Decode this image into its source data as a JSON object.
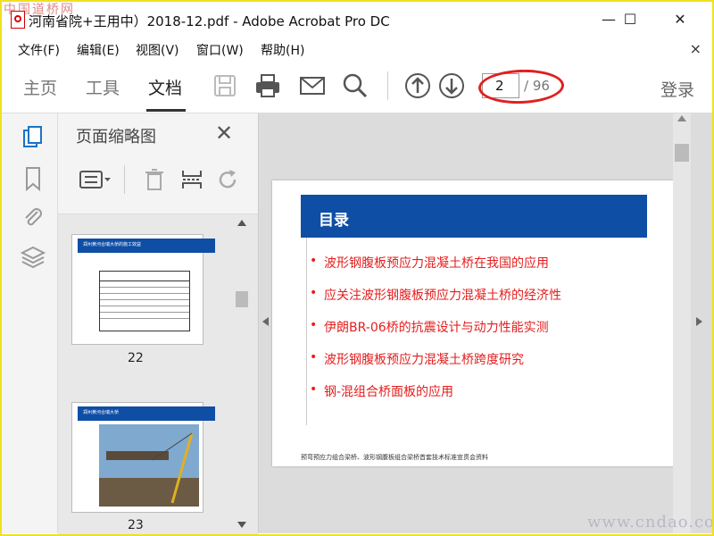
{
  "window": {
    "title": "河南省院+王用中）2018-12.pdf - Adobe Acrobat Pro DC",
    "minimize": "—",
    "maximize": "☐",
    "close": "✕",
    "watermark_top": "中国道桥网"
  },
  "menu": {
    "items": [
      "文件(F)",
      "编辑(E)",
      "视图(V)",
      "窗口(W)",
      "帮助(H)"
    ],
    "close": "×"
  },
  "toolbar": {
    "tabs": [
      {
        "label": "主页",
        "active": false
      },
      {
        "label": "工具",
        "active": false
      },
      {
        "label": "文档",
        "active": true
      }
    ],
    "icons": [
      "save-icon",
      "print-icon",
      "email-icon",
      "search-icon",
      "prev-page-icon",
      "next-page-icon"
    ],
    "current_page": "2",
    "total_pages": "/ 96",
    "login_label": "登录"
  },
  "rail": {
    "icons": [
      "page-thumbnails-icon",
      "bookmark-icon",
      "attachment-icon",
      "layers-icon"
    ]
  },
  "thumbnails_panel": {
    "title": "页面缩略图",
    "close": "✕",
    "tools": [
      "options-menu-icon",
      "delete-page-icon",
      "extract-page-icon",
      "rotate-icon"
    ],
    "pages": [
      {
        "label": "22",
        "header": "郑州黄河合瑞大桥的施工效益"
      },
      {
        "label": "23",
        "header": "郑州黄河合瑞大桥"
      }
    ]
  },
  "document": {
    "page_header": "目录",
    "toc": [
      "波形钢腹板预应力混凝土桥在我国的应用",
      "应关注波形钢腹板预应力混凝土桥的经济性",
      "伊朗BR-06桥的抗震设计与动力性能实测",
      "波形钢腹板预应力混凝土桥跨度研究",
      "钢-混组合桥面板的应用"
    ],
    "footer": "预弯预应力组合梁桥、波形钢腹板组合梁桥首套技术标准宣贯会资料",
    "bullet": "•"
  },
  "watermark_bottom": "www.cndao.com",
  "colors": {
    "accent_blue": "#0f4ea5",
    "toc_red": "#e41e1e",
    "highlight_oval": "#e02020"
  }
}
